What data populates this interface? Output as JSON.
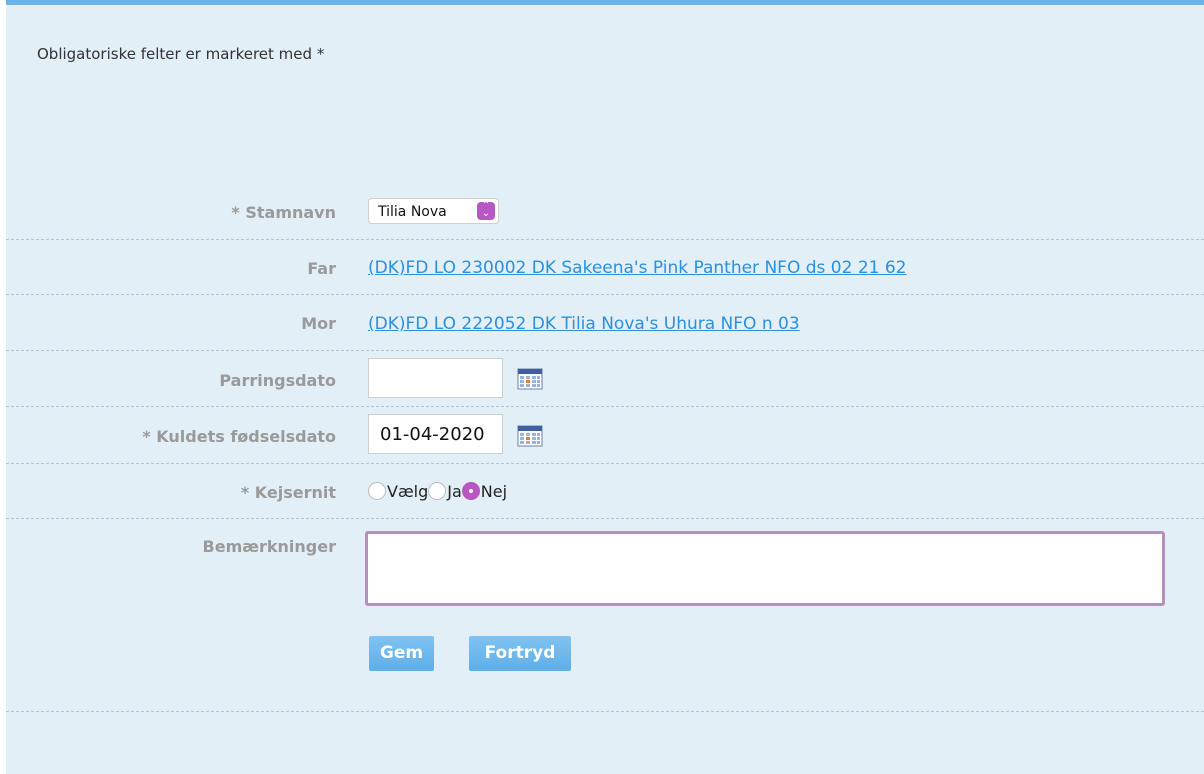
{
  "form": {
    "required_note": "Obligatoriske felter er markeret med *",
    "stamnavn": {
      "label": "* Stamnavn",
      "value": "Tilia Nova"
    },
    "far": {
      "label": "Far",
      "link": "(DK)FD LO 230002 DK Sakeena's Pink Panther NFO ds 02 21 62"
    },
    "mor": {
      "label": "Mor",
      "link": "(DK)FD LO 222052 DK Tilia Nova's Uhura NFO n 03"
    },
    "parringsdato": {
      "label": "Parringsdato",
      "value": ""
    },
    "fodselsdato": {
      "label": "* Kuldets fødselsdato",
      "value": "01-04-2020"
    },
    "kejsernit": {
      "label": "* Kejsernit",
      "options": [
        "Vælg",
        "Ja",
        "Nej"
      ],
      "selected": "Nej"
    },
    "bemaerkninger": {
      "label": "Bemærkninger",
      "value": ""
    },
    "buttons": {
      "save": "Gem",
      "cancel": "Fortryd"
    }
  },
  "colors": {
    "panel_bg": "#e2eff6",
    "top_border": "#6cb3e8",
    "link": "#2b8fe0",
    "accent": "#b657c3",
    "button": "#6cb3e8"
  },
  "icons": {
    "calendar": "calendar-icon",
    "select_arrows": "chevron-updown-icon"
  }
}
